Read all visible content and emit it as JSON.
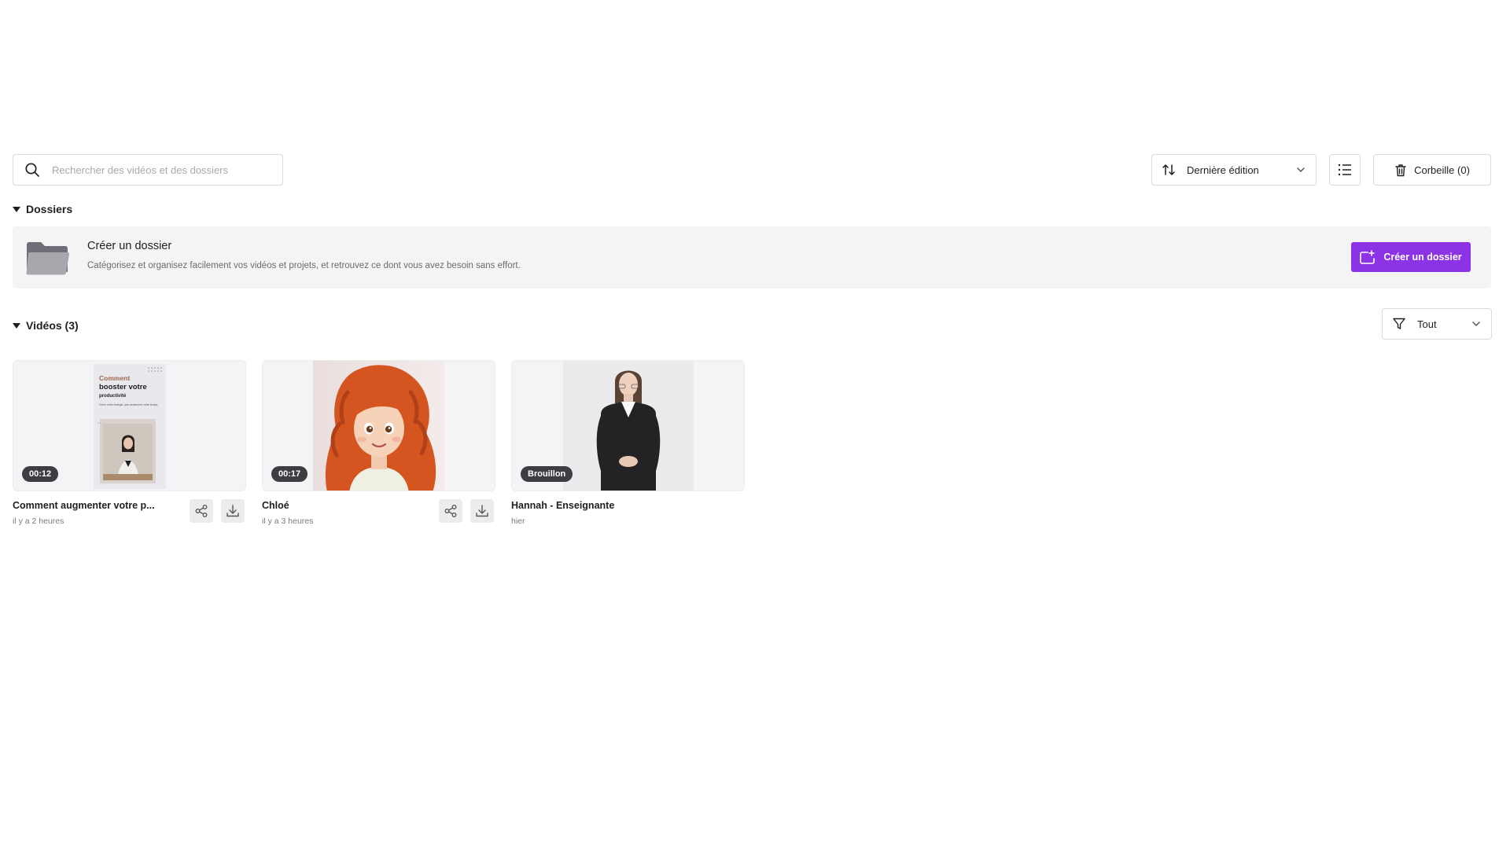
{
  "search": {
    "placeholder": "Rechercher des vidéos et des dossiers"
  },
  "sort": {
    "label": "Dernière édition"
  },
  "trash": {
    "label": "Corbeille (0)"
  },
  "folders": {
    "section_label": "Dossiers",
    "banner_title": "Créer un dossier",
    "banner_description": "Catégorisez et organisez facilement vos vidéos et projets, et retrouvez ce dont vous avez besoin sans effort.",
    "create_button": "Créer un dossier"
  },
  "videos": {
    "section_label": "Vidéos (3)",
    "filter_label": "Tout",
    "items": [
      {
        "badge": "00:12",
        "title": "Comment augmenter votre p...",
        "subtitle": "il y a 2 heures",
        "thumb_text": {
          "line1": "Comment",
          "line2": "booster votre",
          "line3": "productivité",
          "line4": "Gérer votre énergie, pas seulement votre temps."
        }
      },
      {
        "badge": "00:17",
        "title": "Chloé",
        "subtitle": "il y a 3 heures"
      },
      {
        "badge": "Brouillon",
        "title": "Hannah - Enseignante",
        "subtitle": "hier"
      }
    ]
  },
  "colors": {
    "accent": "#8d33e6",
    "badge_bg": "#3d3d42",
    "banner_bg": "#f4f4f5"
  }
}
